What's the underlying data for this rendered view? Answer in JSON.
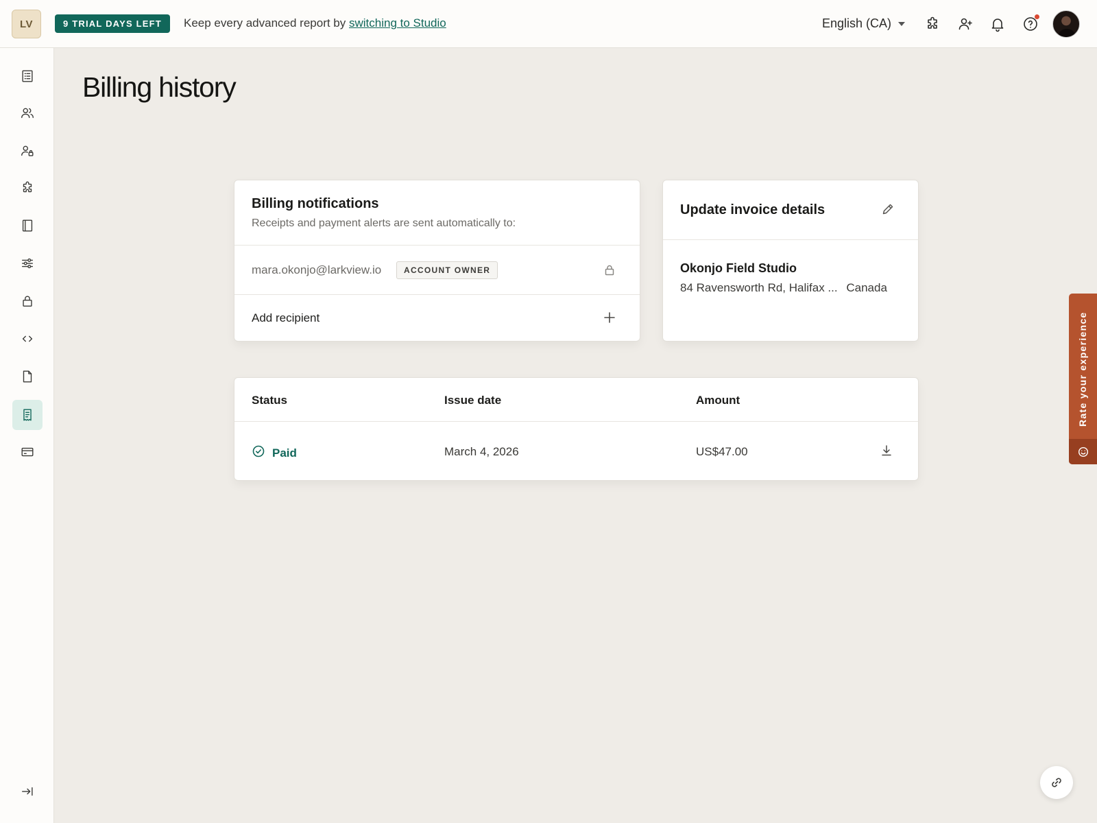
{
  "topbar": {
    "logo_text": "LV",
    "trial_badge": "9 TRIAL DAYS LEFT",
    "promo_text": "Keep every advanced report by",
    "promo_link": "switching to Studio",
    "language": "English (CA)",
    "icons": [
      "puzzle-icon",
      "add-user-icon",
      "bell-icon",
      "help-icon"
    ],
    "notification_dot_color": "#d94a33"
  },
  "sidebar": {
    "items": [
      {
        "icon": "reports-icon"
      },
      {
        "icon": "users-icon"
      },
      {
        "icon": "user-lock-icon"
      },
      {
        "icon": "integrations-icon"
      },
      {
        "icon": "book-icon"
      },
      {
        "icon": "sliders-icon"
      },
      {
        "icon": "lock-icon"
      },
      {
        "icon": "code-icon"
      },
      {
        "icon": "document-icon"
      },
      {
        "icon": "receipt-icon",
        "active": true
      },
      {
        "icon": "credit-card-icon"
      }
    ],
    "collapse_icon": "collapse-sidebar-icon"
  },
  "page": {
    "title": "Billing history"
  },
  "billing_notifications": {
    "title": "Billing notifications",
    "subtitle": "Receipts and payment alerts are sent automatically to:",
    "email": "mara.okonjo@larkview.io",
    "owner_badge": "ACCOUNT OWNER",
    "add_recipient": "Add recipient"
  },
  "invoice_details": {
    "title": "Update invoice details",
    "company": "Okonjo Field Studio",
    "address": "84 Ravensworth Rd, Halifax ...",
    "country": "Canada"
  },
  "history": {
    "columns": [
      "Status",
      "Issue date",
      "Amount"
    ],
    "rows": [
      {
        "status": "Paid",
        "issue_date": "March 4, 2026",
        "amount": "US$47.00"
      }
    ]
  },
  "feedback": {
    "label": "Rate your experience",
    "color": "#b5532e"
  },
  "colors": {
    "accent": "#11675a",
    "background": "#efece7"
  }
}
